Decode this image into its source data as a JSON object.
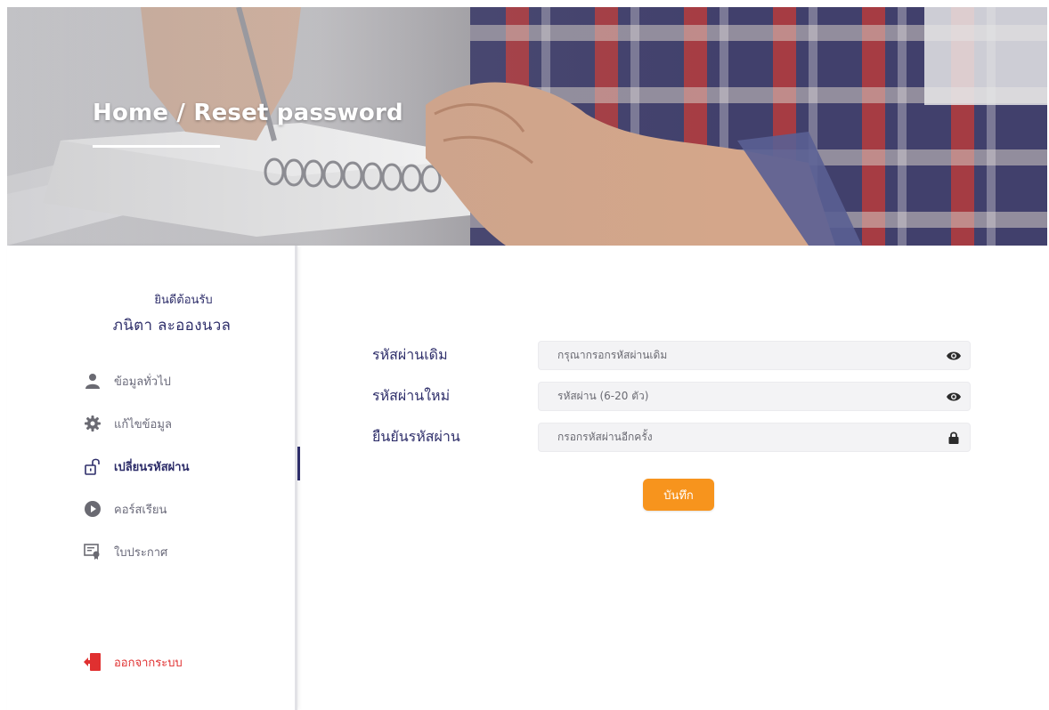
{
  "hero": {
    "title": "Home / Reset password"
  },
  "sidebar": {
    "welcome": "ยินดีต้อนรับ",
    "username": "ภนิตา  ละอองนวล",
    "items": [
      {
        "label": "ข้อมูลทั่วไป",
        "icon": "user-icon",
        "active": false
      },
      {
        "label": "แก้ไขข้อมูล",
        "icon": "gear-icon",
        "active": false
      },
      {
        "label": "เปลี่ยนรหัสผ่าน",
        "icon": "unlock-icon",
        "active": true
      },
      {
        "label": "คอร์สเรียน",
        "icon": "play-circle-icon",
        "active": false
      },
      {
        "label": "ใบประกาศ",
        "icon": "certificate-icon",
        "active": false
      }
    ],
    "logout": {
      "label": "ออกจากระบบ",
      "icon": "logout-door-icon"
    }
  },
  "form": {
    "fields": [
      {
        "label": "รหัสผ่านเดิม",
        "placeholder": "กรุณากรอกรหัสผ่านเดิม",
        "value": "",
        "icon": "eye-icon"
      },
      {
        "label": "รหัสผ่านใหม่",
        "placeholder": "รหัสผ่าน (6-20 ตัว)",
        "value": "",
        "icon": "eye-icon"
      },
      {
        "label": "ยืนยันรหัสผ่าน",
        "placeholder": "กรอกรหัสผ่านอีกครั้ง",
        "value": "",
        "icon": "lock-icon"
      }
    ],
    "save_label": "บันทึก"
  },
  "colors": {
    "primary_text": "#2e2e6a",
    "accent_orange": "#f7941d",
    "logout_red": "#e03030",
    "field_bg": "#f3f3f5"
  }
}
